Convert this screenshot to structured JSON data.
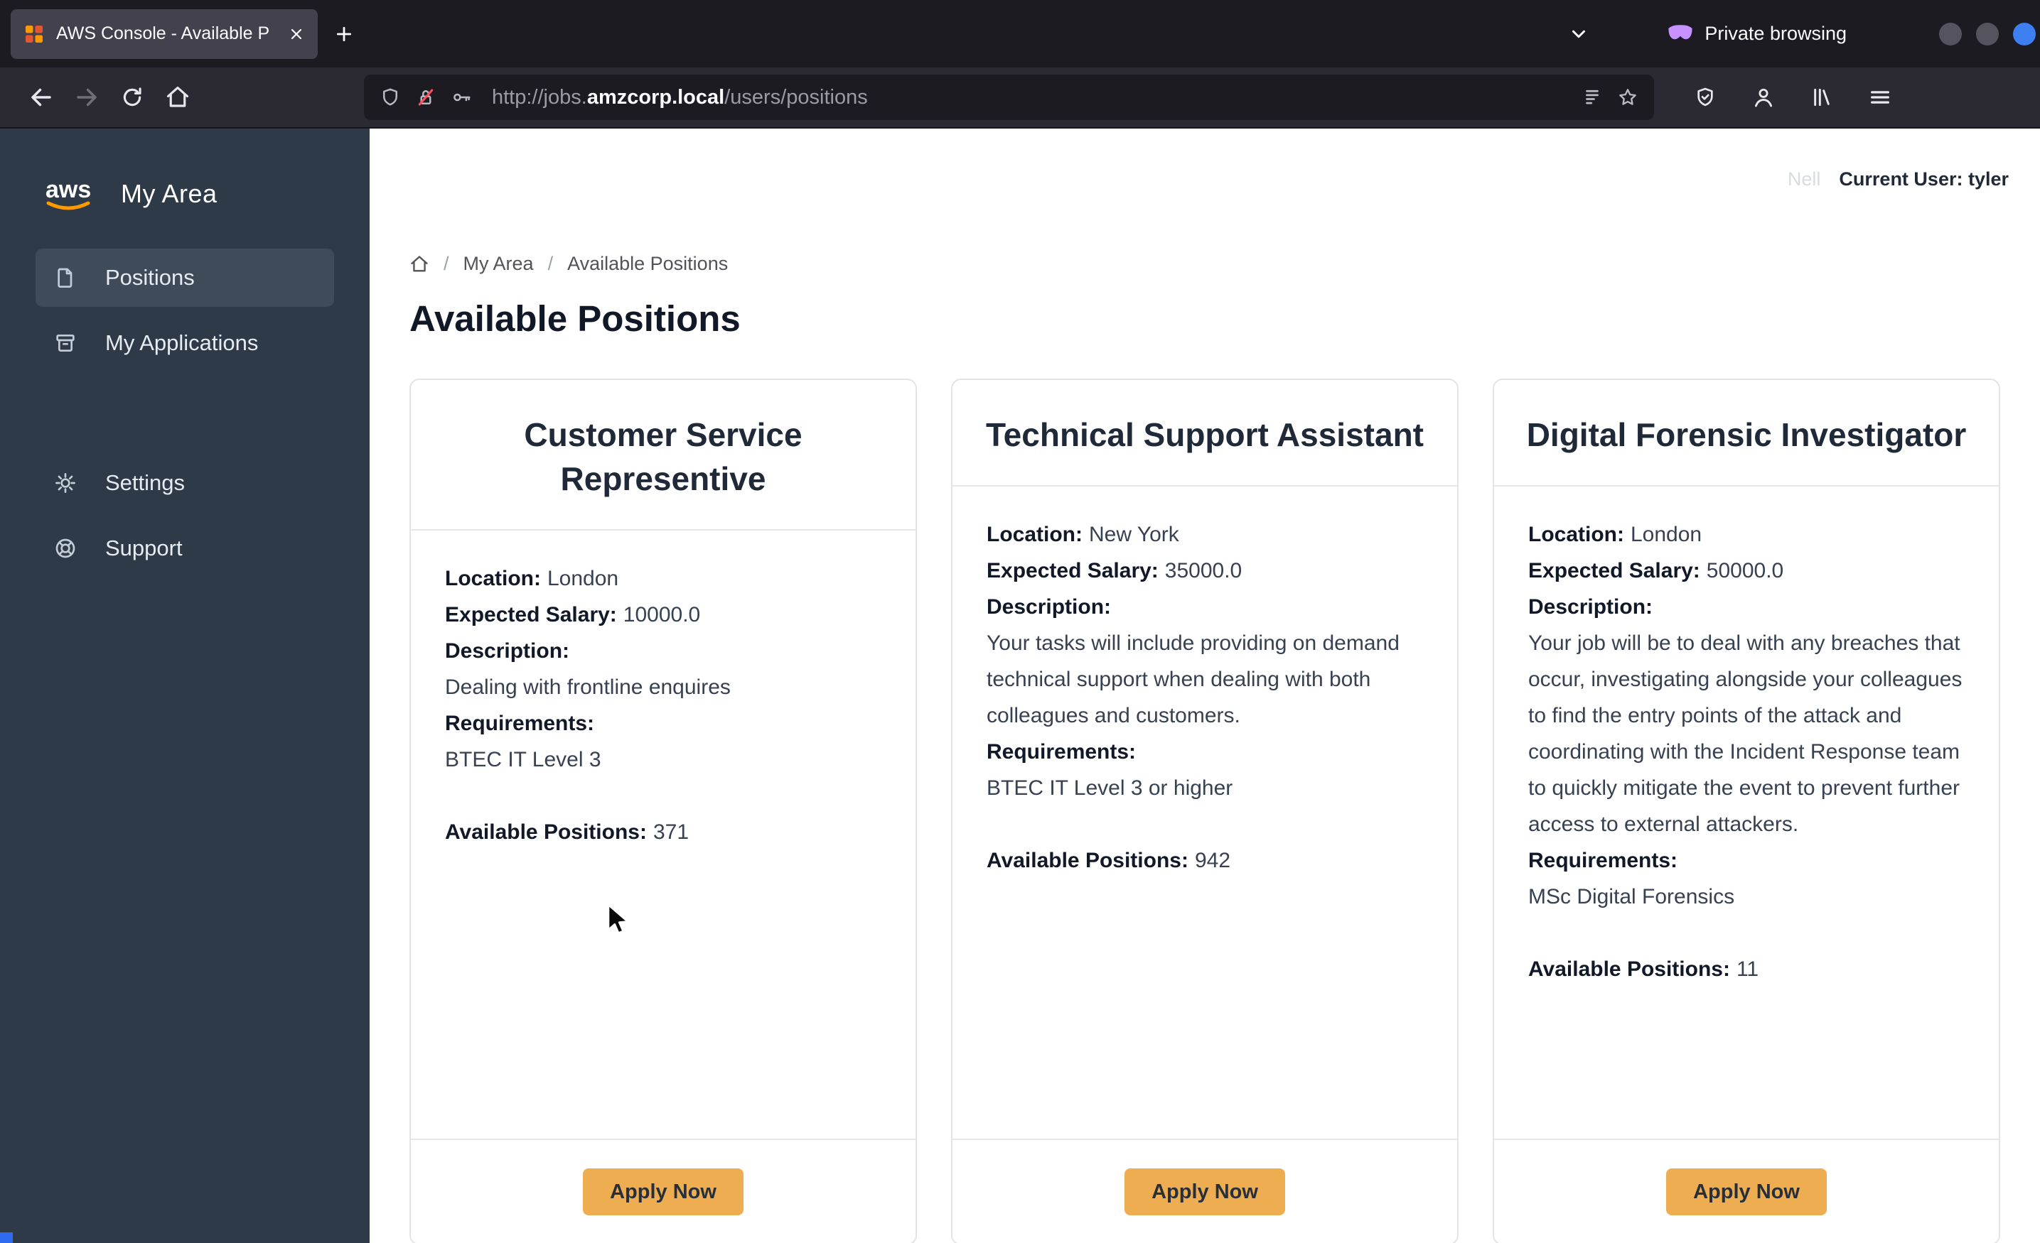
{
  "browser": {
    "tab_title": "AWS Console - Available P",
    "private_label": "Private browsing",
    "url_prefix": "http://jobs.",
    "url_domain": "amzcorp.local",
    "url_path": "/users/positions"
  },
  "sidebar": {
    "title": "My Area",
    "items": [
      {
        "label": "Positions"
      },
      {
        "label": "My Applications"
      },
      {
        "label": "Settings"
      },
      {
        "label": "Support"
      }
    ]
  },
  "header": {
    "faded_text": "Nell",
    "current_user": "Current User: tyler",
    "breadcrumb": {
      "separator": "/",
      "crumbs": [
        "My Area",
        "Available Positions"
      ]
    },
    "title": "Available Positions"
  },
  "card_labels": {
    "location": "Location:",
    "salary": "Expected Salary:",
    "description": "Description:",
    "requirements": "Requirements:",
    "available": "Available Positions:",
    "apply": "Apply Now"
  },
  "positions": [
    {
      "title": "Customer Service Representive",
      "location": "London",
      "salary": "10000.0",
      "description": "Dealing with frontline enquires",
      "requirements": "BTEC IT Level 3",
      "available": "371"
    },
    {
      "title": "Technical Support Assistant",
      "location": "New York",
      "salary": "35000.0",
      "description": "Your tasks will include providing on demand technical support when dealing with both colleagues and customers.",
      "requirements": "BTEC IT Level 3 or higher",
      "available": "942"
    },
    {
      "title": "Digital Forensic Investigator",
      "location": "London",
      "salary": "50000.0",
      "description": "Your job will be to deal with any breaches that occur, investigating alongside your colleagues to find the entry points of the attack and coordinating with the Incident Response team to quickly mitigate the event to prevent further access to external attackers.",
      "requirements": "MSc Digital Forensics",
      "available": "11"
    }
  ]
}
